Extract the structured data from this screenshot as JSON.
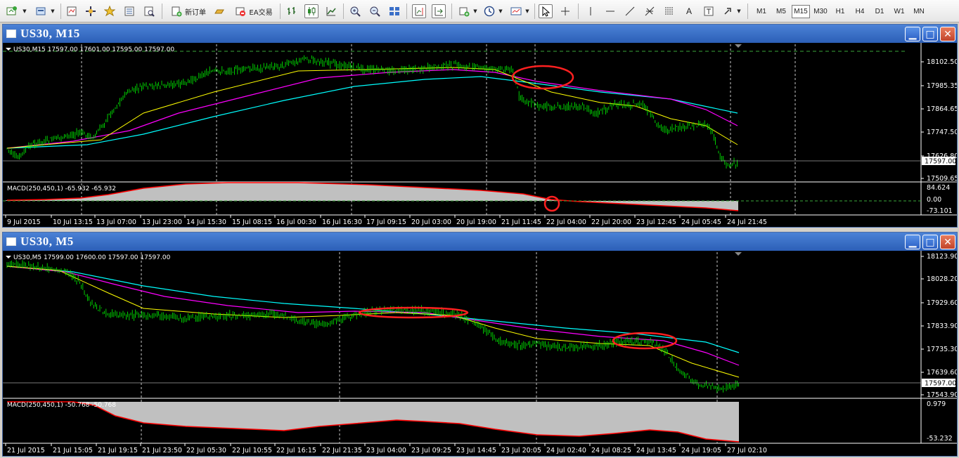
{
  "toolbar": {
    "new_order_label": "新订单",
    "ea_trading_label": "EA交易",
    "text_tool_label": "A",
    "timeframes": [
      "M1",
      "M5",
      "M15",
      "M30",
      "H1",
      "H4",
      "D1",
      "W1",
      "MN"
    ],
    "active_timeframe": "M15"
  },
  "window1": {
    "title": "US30, M15",
    "ohlc_label": "US30,M15  17597.00 17601.00 17595.00 17597.00",
    "macd_label": "MACD(250,450,1) -65.932 -65.932",
    "price_labels": [
      "18102.50",
      "17985.35",
      "17864.65",
      "17747.50",
      "17626.80",
      "17509.65"
    ],
    "current_price": "17597.00",
    "macd_labels": [
      "84.624",
      "0.00",
      "-73.101"
    ],
    "time_labels": [
      "9 Jul 2015",
      "10 Jul 13:15",
      "13 Jul 07:00",
      "13 Jul 23:00",
      "14 Jul 15:30",
      "15 Jul 08:15",
      "16 Jul 00:30",
      "16 Jul 16:30",
      "17 Jul 09:15",
      "20 Jul 03:00",
      "20 Jul 19:00",
      "21 Jul 11:45",
      "22 Jul 04:00",
      "22 Jul 20:00",
      "23 Jul 12:45",
      "24 Jul 05:45",
      "24 Jul 21:45"
    ]
  },
  "window2": {
    "title": "US30, M5",
    "ohlc_label": "US30,M5  17599.00 17600.00 17597.00 17597.00",
    "macd_label": "MACD(250,450,1) -50.768 -50.768",
    "price_labels": [
      "18123.90",
      "18028.20",
      "17929.60",
      "17833.90",
      "17735.30",
      "17639.60",
      "17543.90"
    ],
    "current_price": "17597.00",
    "macd_labels": [
      "0.979",
      "-53.232"
    ],
    "time_labels": [
      "21 Jul 2015",
      "21 Jul 15:05",
      "21 Jul 19:15",
      "21 Jul 23:50",
      "22 Jul 05:30",
      "22 Jul 10:55",
      "22 Jul 16:15",
      "22 Jul 21:35",
      "23 Jul 04:00",
      "23 Jul 09:25",
      "23 Jul 14:45",
      "23 Jul 20:05",
      "24 Jul 02:40",
      "24 Jul 08:25",
      "24 Jul 13:45",
      "24 Jul 19:05",
      "27 Jul 02:10"
    ]
  },
  "colors": {
    "candle": "#00ff00",
    "ma_fast": "#ffff00",
    "ma_mid": "#ff00ff",
    "ma_slow": "#00ffff",
    "macd_hist": "#c0c0c0",
    "macd_signal": "#ff0000",
    "highlight_circle": "#ff2020",
    "title_bar": "#3a70c8"
  },
  "icons": [
    "new-chart-icon",
    "profiles-icon",
    "market-watch-icon",
    "navigator-icon",
    "favorites-icon",
    "data-window-icon",
    "strategy-tester-icon",
    "new-order-icon",
    "autotrading-icon",
    "bar-chart-icon",
    "candlestick-icon",
    "line-chart-icon",
    "zoom-in-icon",
    "zoom-out-icon",
    "tile-windows-icon",
    "chart-shift-icon",
    "auto-scroll-icon",
    "indicators-icon",
    "periods-icon",
    "templates-icon",
    "cursor-icon",
    "crosshair-icon",
    "vertical-line-icon",
    "horizontal-line-icon",
    "trendline-icon",
    "fibonacci-icon",
    "fib-retracement-icon",
    "text-icon",
    "text-label-icon",
    "arrows-icon"
  ]
}
